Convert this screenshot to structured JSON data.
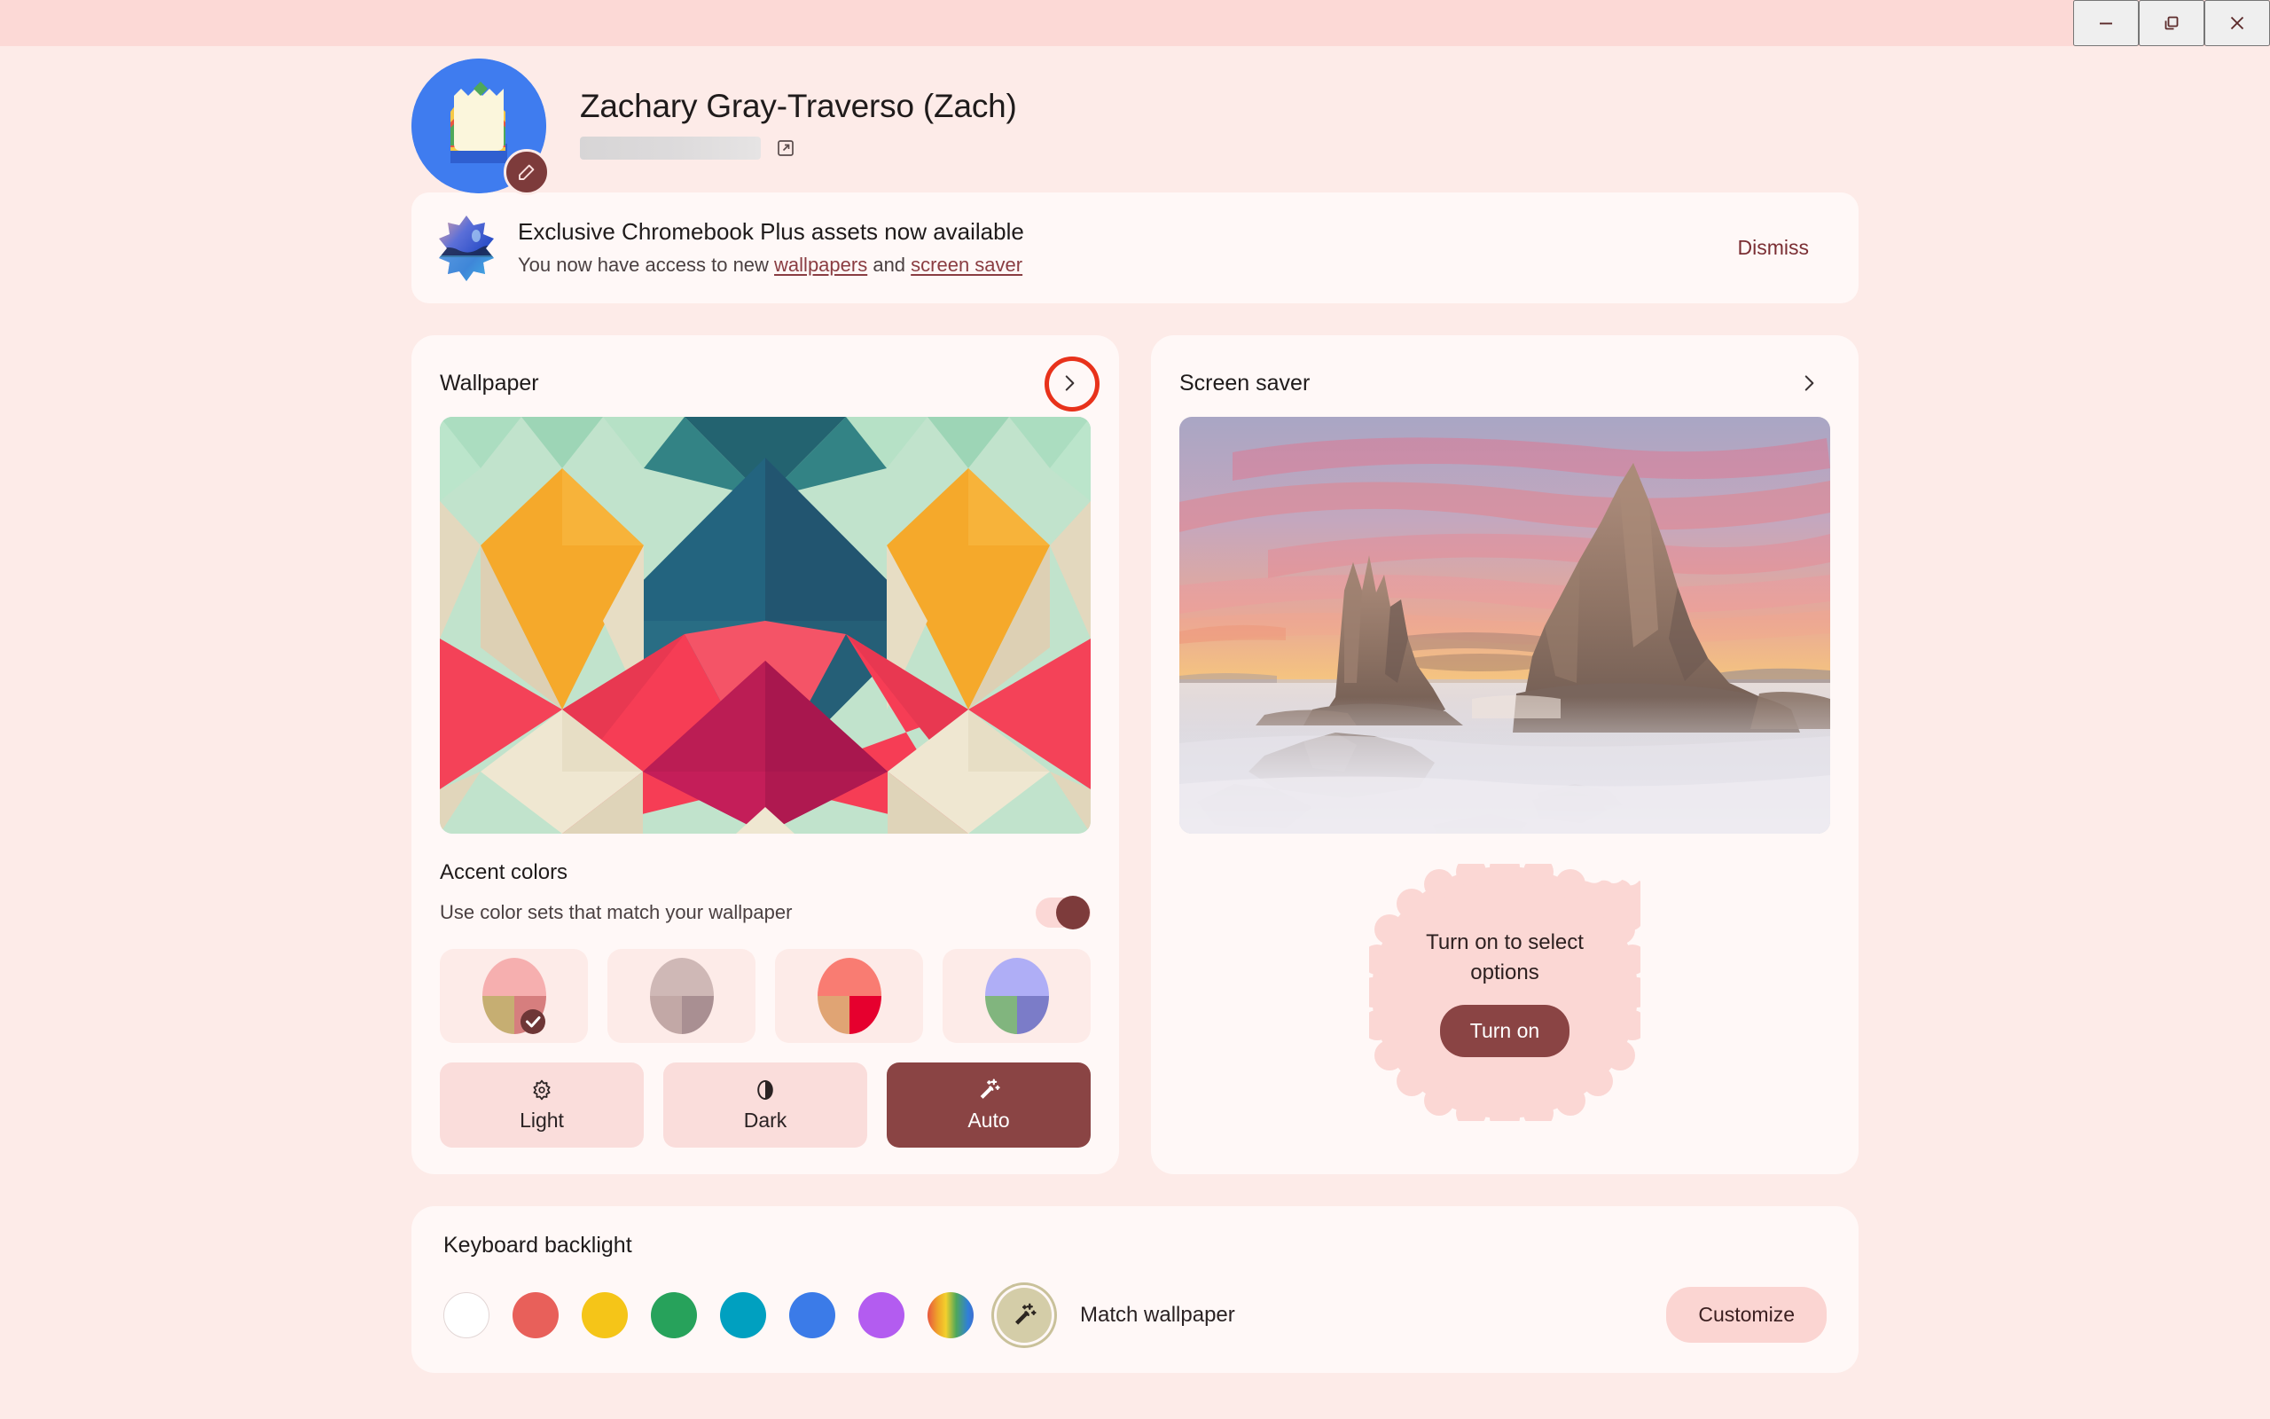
{
  "window": {
    "minimize_label": "Minimize",
    "restore_label": "Restore",
    "close_label": "Close"
  },
  "user": {
    "name": "Zachary Gray-Traverso (Zach)",
    "email_redacted": true,
    "avatar_icon": "sandwich-avatar",
    "edit_icon": "pencil-icon",
    "external_link_icon": "open-in-new-icon"
  },
  "banner": {
    "icon": "chromebook-plus-sparkle-icon",
    "title": "Exclusive Chromebook Plus assets now available",
    "subtitle_prefix": "You now have access to new ",
    "link_wallpapers": "wallpapers",
    "subtitle_middle": " and ",
    "link_screensaver": "screen saver",
    "dismiss_label": "Dismiss"
  },
  "wallpaper_card": {
    "title": "Wallpaper",
    "chevron_icon": "chevron-right-icon",
    "preview_alt": "geometric-diamond-wallpaper",
    "annotation": "red-circle-highlight",
    "accent": {
      "title": "Accent colors",
      "subtitle": "Use color sets that match your wallpaper",
      "toggle_on": true,
      "swatches": [
        {
          "name": "swatch-pink-tan",
          "top": "#F6AFAF",
          "bottom_left": "#C6AE72",
          "bottom_right": "#D67E7E",
          "selected": true
        },
        {
          "name": "swatch-mauve",
          "top": "#CFB8B6",
          "bottom_left": "#C2A8A6",
          "bottom_right": "#A98F92",
          "selected": false
        },
        {
          "name": "swatch-coral-red",
          "top": "#F97C72",
          "bottom_left": "#E0A474",
          "bottom_right": "#E6002E",
          "selected": false
        },
        {
          "name": "swatch-periwinkle-green",
          "top": "#AFAEF6",
          "bottom_left": "#81B57E",
          "bottom_right": "#7B7CC8",
          "selected": false
        }
      ],
      "check_icon": "check-circle-icon"
    },
    "modes": [
      {
        "label": "Light",
        "icon": "sun-icon",
        "selected": false
      },
      {
        "label": "Dark",
        "icon": "half-moon-contrast-icon",
        "selected": false
      },
      {
        "label": "Auto",
        "icon": "magic-wand-icon",
        "selected": true
      }
    ]
  },
  "screensaver_card": {
    "title": "Screen saver",
    "chevron_icon": "chevron-right-icon",
    "preview_alt": "sunset-sea-stacks-photo",
    "prompt_text": "Turn on to select options",
    "turn_on_label": "Turn on"
  },
  "keyboard_backlight": {
    "title": "Keyboard backlight",
    "colors": [
      {
        "name": "kb-color-white",
        "hex": "#FFFFFF"
      },
      {
        "name": "kb-color-red",
        "hex": "#E8605A"
      },
      {
        "name": "kb-color-yellow",
        "hex": "#F5C518"
      },
      {
        "name": "kb-color-green",
        "hex": "#27A25B"
      },
      {
        "name": "kb-color-teal",
        "hex": "#00A0C0"
      },
      {
        "name": "kb-color-blue",
        "hex": "#3B7BE8"
      },
      {
        "name": "kb-color-purple",
        "hex": "#B35CF0"
      },
      {
        "name": "kb-color-rainbow",
        "hex": "rainbow"
      }
    ],
    "match_wallpaper": {
      "icon": "magic-wand-icon",
      "label": "Match wallpaper",
      "selected": true
    },
    "customize_label": "Customize"
  },
  "colors": {
    "page_background": "#FDEBE8",
    "titlebar": "#FCD9D6",
    "card_surface": "#FFF8F7",
    "accent_maroon": "#8A4444",
    "accent_dark": "#7D3B3B",
    "annotation_red": "#E8321B",
    "text_primary": "#1F1B1B",
    "text_secondary": "#4A4041"
  }
}
